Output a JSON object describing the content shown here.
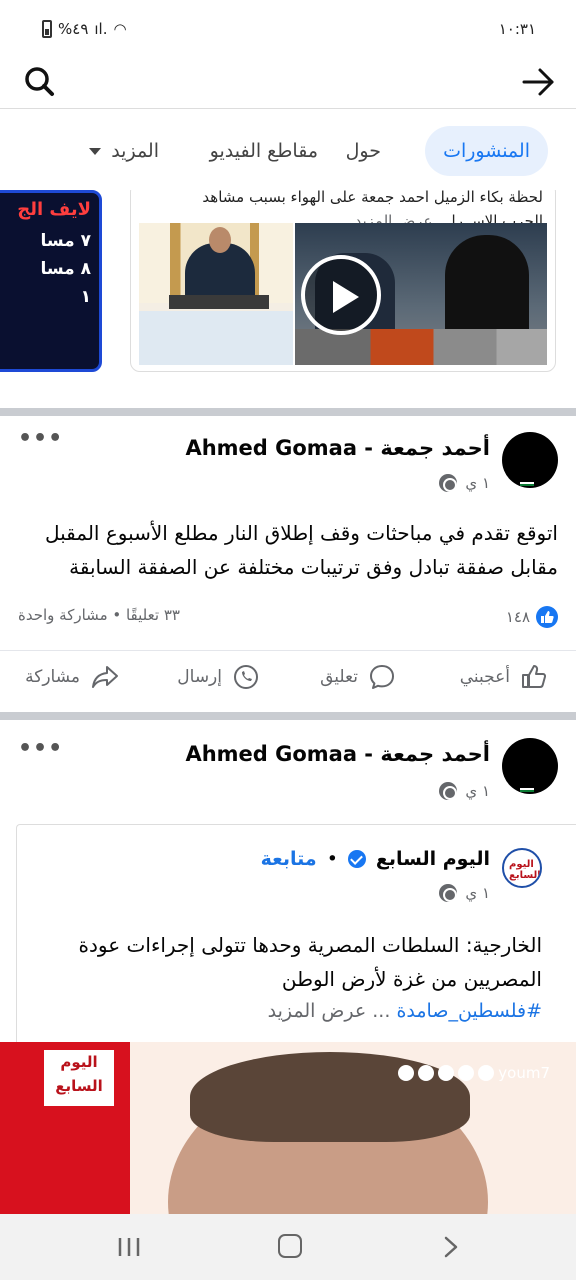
{
  "status_bar": {
    "time": "١٠:٣١",
    "battery": "%٤٩"
  },
  "tabs": [
    {
      "label": "المنشورات",
      "active": true
    },
    {
      "label": "حول"
    },
    {
      "label": "مقاطع الفيديو"
    },
    {
      "label": "المزيد"
    }
  ],
  "top_cards": {
    "dark_card": {
      "line1": "لايف الج",
      "line2": "٧ مسا",
      "line3": "٨ مسا",
      "line4": "١"
    },
    "news_card": {
      "text_line1": "لحظة بكاء الزميل أحمد جمعة على الهواء بسبب مشاهد",
      "text_line2": "الحرب الإسـ را...",
      "see_more": "عرض المزيد"
    }
  },
  "post1": {
    "author": "أحمد جمعة - Ahmed Gomaa",
    "meta": "١ ي",
    "body": "اتوقع تقدم في مباحثات وقف إطلاق النار مطلع الأسبوع المقبل مقابل صفقة تبادل وفق ترتيبات مختلفة عن الصفقة السابقة",
    "reactions_count": "١٤٨",
    "comments_shares": "٣٣ تعليقًا • مشاركة واحدة",
    "actions": {
      "like": "أعجبني",
      "comment": "تعليق",
      "send": "إرسال",
      "share": "مشاركة"
    }
  },
  "post2": {
    "author": "أحمد جمعة - Ahmed Gomaa",
    "meta": "١ ي",
    "shared": {
      "page_name": "اليوم السابع",
      "follow_label": "متابعة",
      "separator": "•",
      "meta": "١ ي",
      "body": "الخارجية: السلطات المصرية وحدها تتولى إجراءات عودة المصريين من غزة لأرض الوطن",
      "hashtag": "#فلسطين_صامدة",
      "see_more": "... عرض المزيد",
      "avatar_text": "اليوم السابع",
      "image_logo": "اليوم السابع",
      "image_handle": "youm7"
    }
  },
  "colors": {
    "accent": "#1877f2",
    "tab_active_bg": "#e7f0fd",
    "text_secondary": "#65676b",
    "separator": "#c9ccd1"
  },
  "icons": [
    "search-icon",
    "back-arrow-icon",
    "globe-icon",
    "like-icon",
    "comment-icon",
    "whatsapp-send-icon",
    "share-icon",
    "play-icon",
    "verified-icon"
  ]
}
